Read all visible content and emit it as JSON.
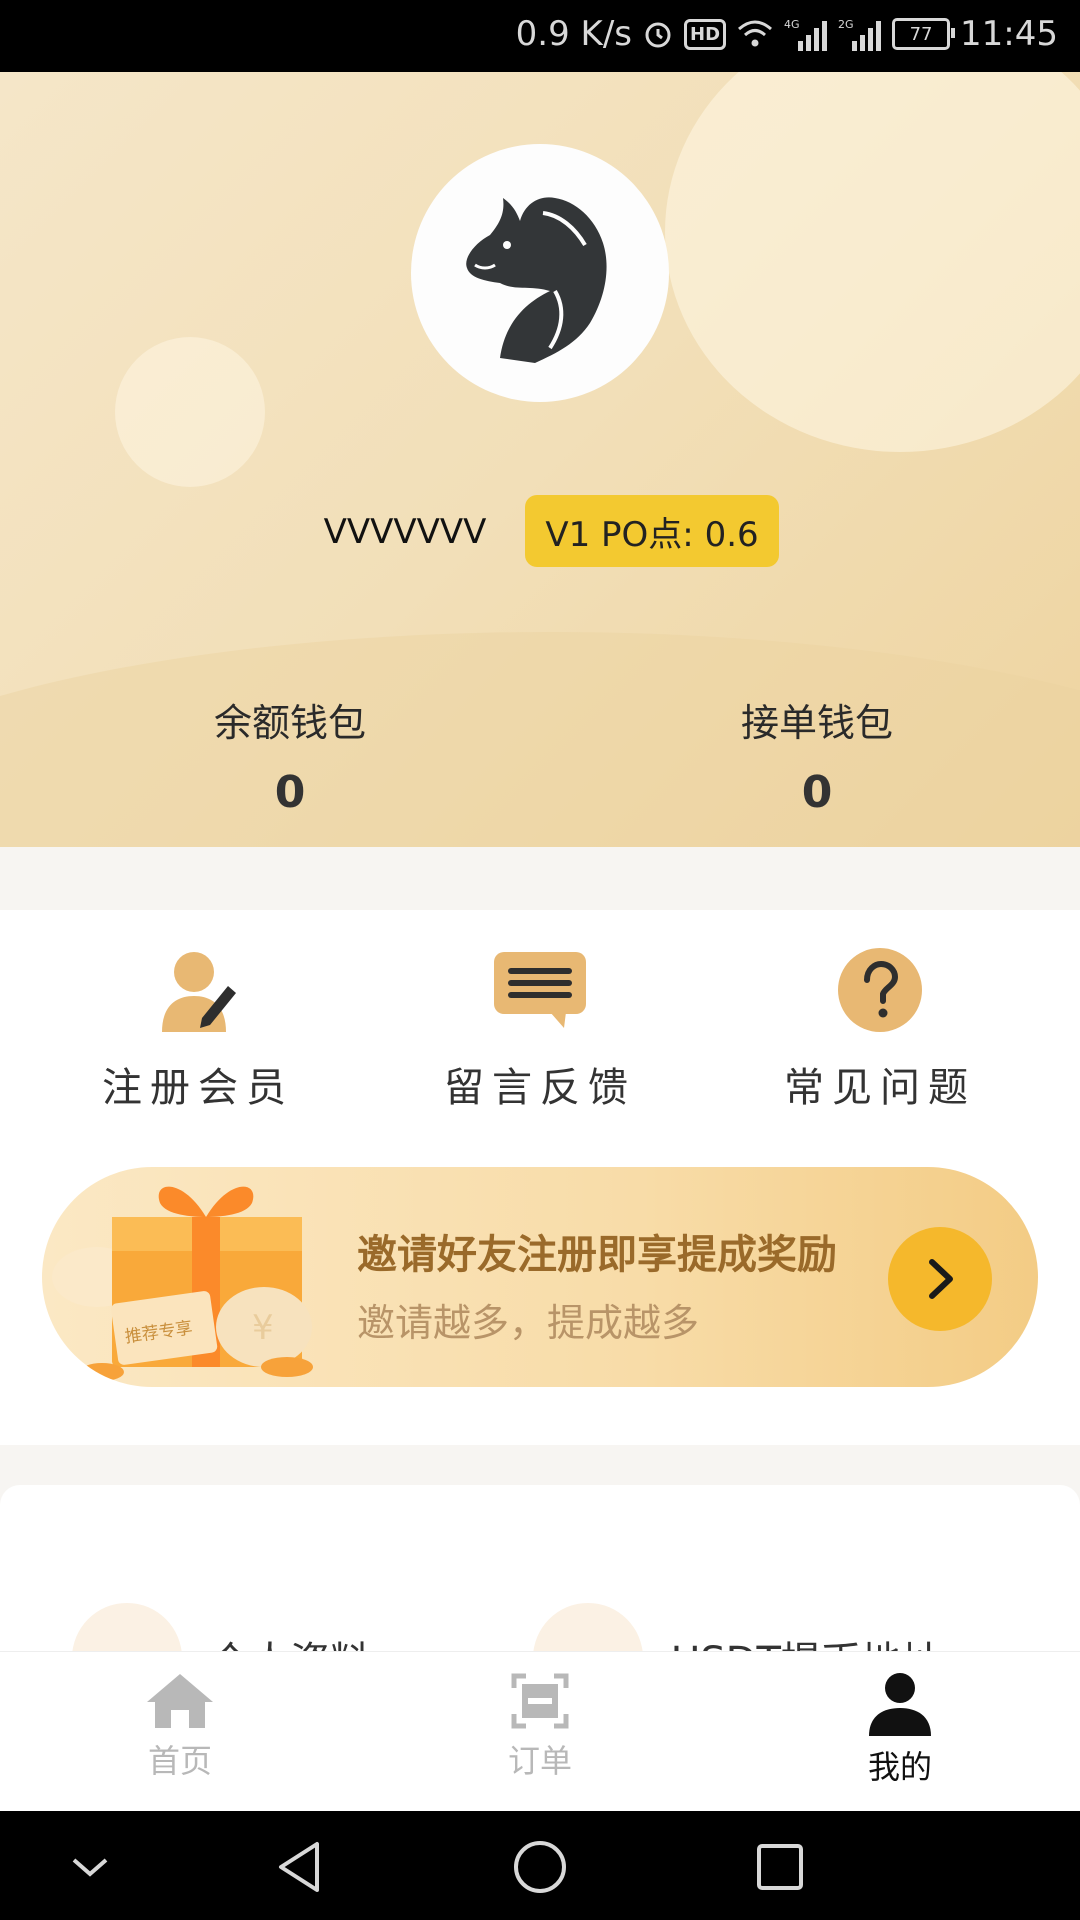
{
  "status_bar": {
    "speed": "0.9 K/s",
    "hd": "HD",
    "net1": "4G",
    "net2": "2G",
    "battery": "77",
    "time": "11:45"
  },
  "profile": {
    "username": "VVVVVVV",
    "vip_label": "V1 PO点: 0.6"
  },
  "wallets": [
    {
      "label": "余额钱包",
      "value": "0"
    },
    {
      "label": "接单钱包",
      "value": "0"
    }
  ],
  "menu": [
    {
      "label": "注册会员",
      "icon": "register-member-icon"
    },
    {
      "label": "留言反馈",
      "icon": "message-feedback-icon"
    },
    {
      "label": "常见问题",
      "icon": "faq-icon"
    }
  ],
  "banner": {
    "title": "邀请好友注册即享提成奖励",
    "subtitle": "邀请越多，提成越多",
    "tag": "推荐专享"
  },
  "settings": [
    {
      "label": "个人资料"
    },
    {
      "label": "USDT提币地址"
    }
  ],
  "tabs": [
    {
      "label": "首页",
      "icon": "home-icon"
    },
    {
      "label": "订单",
      "icon": "order-icon"
    },
    {
      "label": "我的",
      "icon": "profile-icon"
    }
  ],
  "colors": {
    "accent": "#f3c930",
    "active_tab": "#111111",
    "inactive_tab": "#b8b8b8",
    "icon_gold": "#e8b873"
  }
}
